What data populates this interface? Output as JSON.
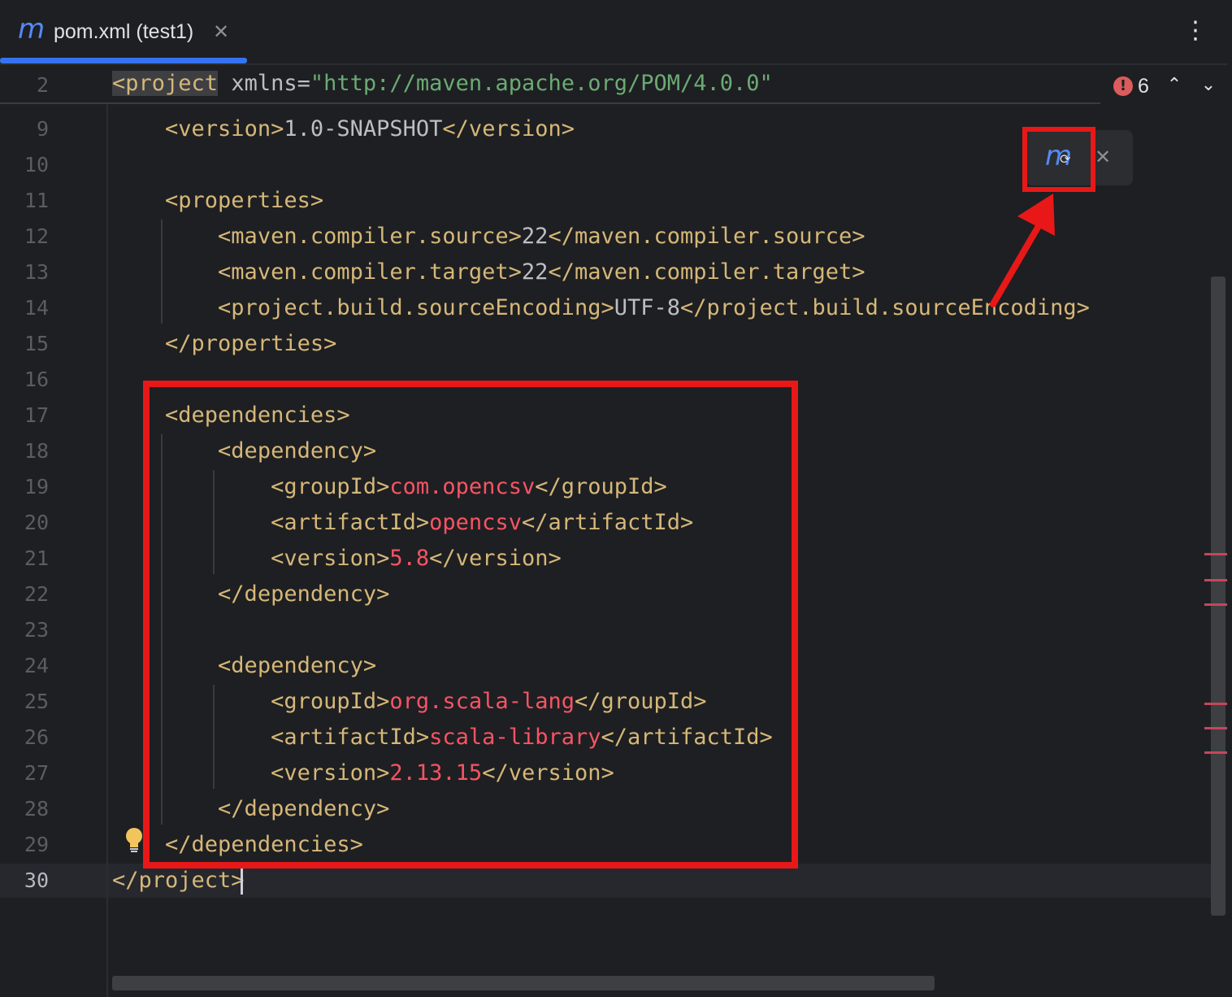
{
  "tab": {
    "icon": "maven-icon",
    "icon_glyph": "m",
    "title": "pom.xml (test1)",
    "close_glyph": "✕"
  },
  "more_menu_glyph": "⋮",
  "sticky": {
    "line_number": "2",
    "tag_open": "<project",
    "attr_name": "xmlns",
    "attr_eq": "=",
    "attr_value": "\"http://maven.apache.org/POM/4.0.0\""
  },
  "problems": {
    "icon": "error-icon",
    "icon_glyph": "!",
    "count": "6",
    "prev_glyph": "⌃",
    "next_glyph": "⌄"
  },
  "maven_reload": {
    "icon": "maven-reload-icon",
    "icon_glyph": "m",
    "sub_glyph": "⟳",
    "close_glyph": "✕"
  },
  "editor": {
    "current_line": "30",
    "lines": [
      {
        "n": "9",
        "indent": "    ",
        "parts": [
          [
            "t",
            "<version>"
          ],
          [
            "x",
            "1.0-SNAPSHOT"
          ],
          [
            "t",
            "</version>"
          ]
        ]
      },
      {
        "n": "10",
        "indent": "",
        "parts": []
      },
      {
        "n": "11",
        "indent": "    ",
        "parts": [
          [
            "t",
            "<properties>"
          ]
        ]
      },
      {
        "n": "12",
        "indent": "        ",
        "parts": [
          [
            "t",
            "<maven.compiler.source>"
          ],
          [
            "x",
            "22"
          ],
          [
            "t",
            "</maven.compiler.source>"
          ]
        ]
      },
      {
        "n": "13",
        "indent": "        ",
        "parts": [
          [
            "t",
            "<maven.compiler.target>"
          ],
          [
            "x",
            "22"
          ],
          [
            "t",
            "</maven.compiler.target>"
          ]
        ]
      },
      {
        "n": "14",
        "indent": "        ",
        "parts": [
          [
            "t",
            "<project.build.sourceEncoding>"
          ],
          [
            "x",
            "UTF-8"
          ],
          [
            "t",
            "</project.build.sourceEncoding>"
          ]
        ]
      },
      {
        "n": "15",
        "indent": "    ",
        "parts": [
          [
            "t",
            "</properties>"
          ]
        ]
      },
      {
        "n": "16",
        "indent": "",
        "parts": []
      },
      {
        "n": "17",
        "indent": "    ",
        "parts": [
          [
            "t",
            "<dependencies>"
          ]
        ]
      },
      {
        "n": "18",
        "indent": "        ",
        "parts": [
          [
            "t",
            "<dependency>"
          ]
        ]
      },
      {
        "n": "19",
        "indent": "            ",
        "parts": [
          [
            "t",
            "<groupId>"
          ],
          [
            "v",
            "com.opencsv"
          ],
          [
            "t",
            "</groupId>"
          ]
        ]
      },
      {
        "n": "20",
        "indent": "            ",
        "parts": [
          [
            "t",
            "<artifactId>"
          ],
          [
            "v",
            "opencsv"
          ],
          [
            "t",
            "</artifactId>"
          ]
        ]
      },
      {
        "n": "21",
        "indent": "            ",
        "parts": [
          [
            "t",
            "<version>"
          ],
          [
            "v",
            "5.8"
          ],
          [
            "t",
            "</version>"
          ]
        ]
      },
      {
        "n": "22",
        "indent": "        ",
        "parts": [
          [
            "t",
            "</dependency>"
          ]
        ]
      },
      {
        "n": "23",
        "indent": "",
        "parts": []
      },
      {
        "n": "24",
        "indent": "        ",
        "parts": [
          [
            "t",
            "<dependency>"
          ]
        ]
      },
      {
        "n": "25",
        "indent": "            ",
        "parts": [
          [
            "t",
            "<groupId>"
          ],
          [
            "v",
            "org.scala-lang"
          ],
          [
            "t",
            "</groupId>"
          ]
        ]
      },
      {
        "n": "26",
        "indent": "            ",
        "parts": [
          [
            "t",
            "<artifactId>"
          ],
          [
            "v",
            "scala-library"
          ],
          [
            "t",
            "</artifactId>"
          ]
        ]
      },
      {
        "n": "27",
        "indent": "            ",
        "parts": [
          [
            "t",
            "<version>"
          ],
          [
            "v",
            "2.13.15"
          ],
          [
            "t",
            "</version>"
          ]
        ]
      },
      {
        "n": "28",
        "indent": "        ",
        "parts": [
          [
            "t",
            "</dependency>"
          ]
        ]
      },
      {
        "n": "29",
        "indent": "    ",
        "parts": [
          [
            "t",
            "</dependencies>"
          ]
        ]
      },
      {
        "n": "30",
        "indent": "",
        "parts": [
          [
            "t",
            "</project>"
          ]
        ]
      }
    ]
  },
  "colors": {
    "accent": "#3574f0",
    "maven_blue": "#548af7",
    "tag": "#d5b778",
    "value_error": "#f75464",
    "string": "#6aab73",
    "annotation": "#e81818"
  }
}
